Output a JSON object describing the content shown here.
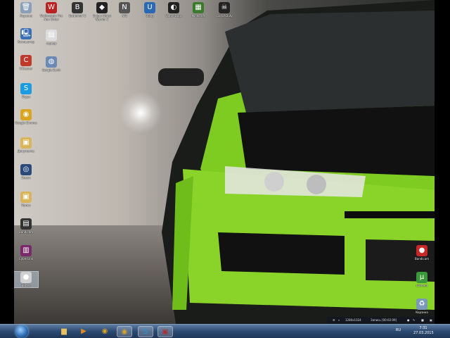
{
  "desktop": {
    "icons_left": [
      {
        "id": "trash",
        "label": "Корзина",
        "glyph": "🗑",
        "color": "#8aa0b8"
      },
      {
        "id": "computer",
        "label": "Компьютер",
        "glyph": "🖳",
        "color": "#3b6fb5"
      },
      {
        "id": "ccleaner",
        "label": "CCleaner",
        "glyph": "C",
        "color": "#c0392b"
      },
      {
        "id": "skype",
        "label": "Skype",
        "glyph": "S",
        "color": "#1b9be0"
      },
      {
        "id": "chrome",
        "label": "Google Chrome",
        "glyph": "◉",
        "color": "#d9a520"
      },
      {
        "id": "folder1",
        "label": "Документы",
        "glyph": "▣",
        "color": "#d8b45a"
      },
      {
        "id": "steam",
        "label": "Steam",
        "glyph": "◎",
        "color": "#2a4a7a"
      },
      {
        "id": "folder2",
        "label": "Папка",
        "glyph": "▣",
        "color": "#d8b45a"
      },
      {
        "id": "terminal",
        "label": "Bandicam",
        "glyph": "▤",
        "color": "#333"
      },
      {
        "id": "winrar",
        "label": "CyberLink",
        "glyph": "▥",
        "color": "#7a2a6a"
      },
      {
        "id": "selected",
        "label": "Видео",
        "glyph": "●",
        "color": "#d0d0d0"
      }
    ],
    "icons_top": [
      {
        "id": "wolfenstein",
        "label": "Wolfenstein The New Order",
        "glyph": "W",
        "color": "#b22"
      },
      {
        "id": "battlefield",
        "label": "Battlefield 3",
        "glyph": "B",
        "color": "#333"
      },
      {
        "id": "sniper",
        "label": "Sniper Ghost Warrior 2",
        "glyph": "◆",
        "color": "#222"
      },
      {
        "id": "nfs",
        "label": "NFS",
        "glyph": "N",
        "color": "#555"
      },
      {
        "id": "uplay",
        "label": "Uplay",
        "glyph": "U",
        "color": "#2a6ab5"
      },
      {
        "id": "watchdogs",
        "label": "Watch Dogs",
        "glyph": "◐",
        "color": "#222"
      },
      {
        "id": "minecraft",
        "label": "Minecraft",
        "glyph": "▦",
        "color": "#3a7a2a"
      },
      {
        "id": "spirit",
        "label": "Call of Duty",
        "glyph": "☠",
        "color": "#222"
      }
    ],
    "icons_second": [
      {
        "id": "file",
        "label": "сервер",
        "glyph": "▤",
        "color": "#ddd"
      },
      {
        "id": "origin",
        "label": "Google Earth",
        "glyph": "◍",
        "color": "#6a8ab5"
      }
    ],
    "icons_right": [
      {
        "id": "bandicam",
        "label": "Bandicam",
        "glyph": "●",
        "color": "#c62828"
      },
      {
        "id": "utorrent",
        "label": "uTorrent",
        "glyph": "µ",
        "color": "#3a9a3a"
      },
      {
        "id": "recycle",
        "label": "Корзина",
        "glyph": "♻",
        "color": "#7a9ab8"
      }
    ]
  },
  "overlay": {
    "resolution": "1280x1024",
    "record": "Запись [00:02:09]"
  },
  "taskbar": {
    "pinned": [
      {
        "id": "explorer",
        "glyph": "▆",
        "color": "#e8c060"
      },
      {
        "id": "media",
        "glyph": "▶",
        "color": "#e08a20"
      },
      {
        "id": "chrome-a",
        "glyph": "◉",
        "color": "#d9a520"
      },
      {
        "id": "chrome-b",
        "glyph": "◉",
        "color": "#d9a520"
      },
      {
        "id": "skype",
        "glyph": "S",
        "color": "#1b9be0"
      },
      {
        "id": "app",
        "glyph": "▣",
        "color": "#a33"
      }
    ],
    "lang": "RU",
    "time": "7:31",
    "date": "27.03.2015"
  }
}
